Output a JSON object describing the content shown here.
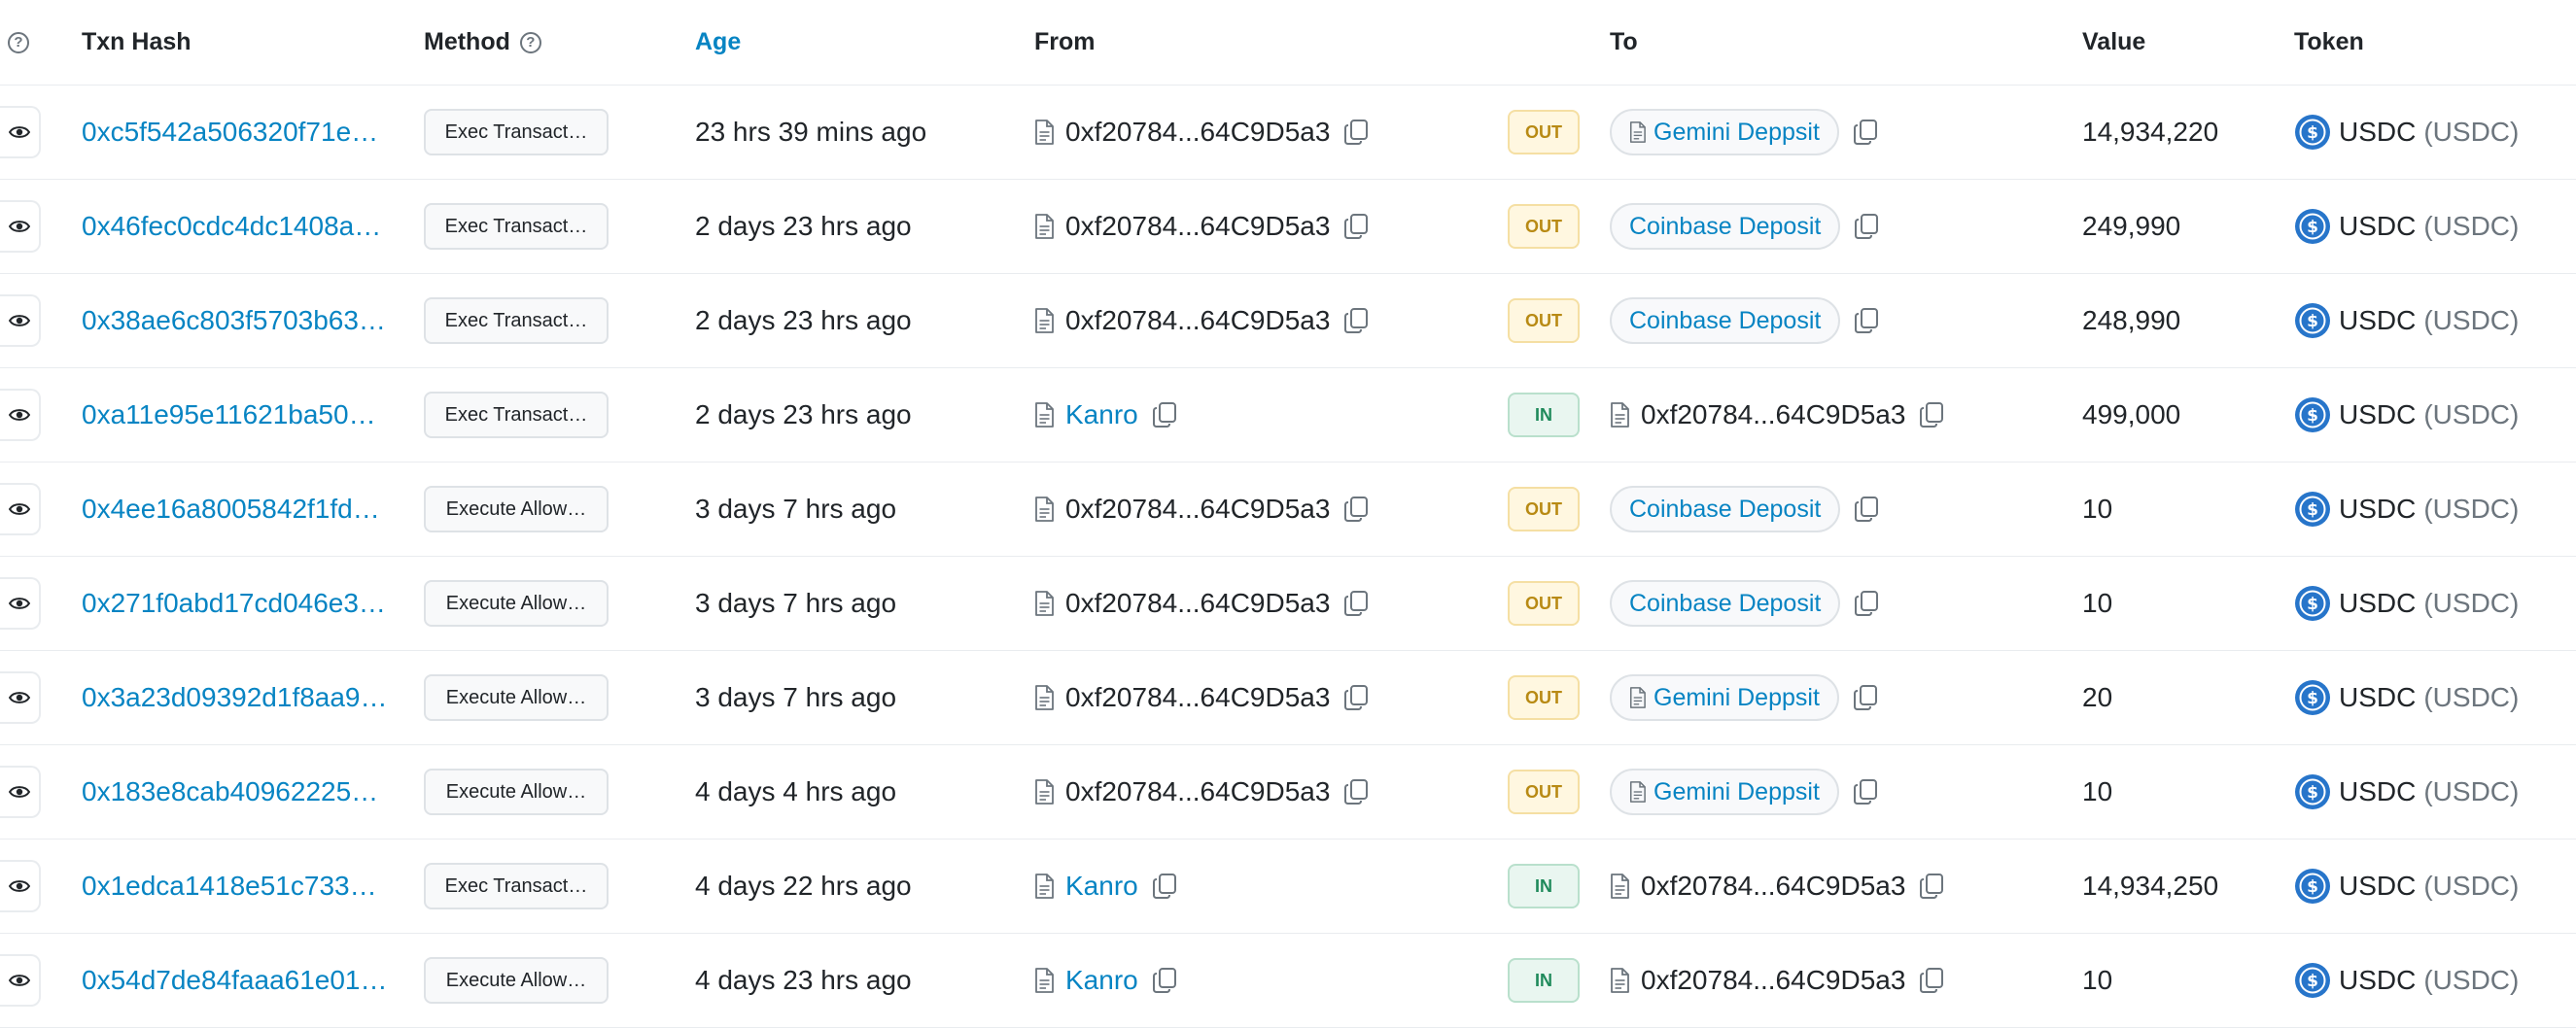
{
  "header": {
    "txn_hash": "Txn Hash",
    "method": "Method",
    "age": "Age",
    "from": "From",
    "to": "To",
    "value": "Value",
    "token": "Token",
    "help_glyph": "?"
  },
  "rows": [
    {
      "hash": "0xc5f542a506320f71e…",
      "method": "Exec Transact…",
      "age": "23 hrs 39 mins ago",
      "from": "0xf20784...64C9D5a3",
      "direction": "OUT",
      "to": "Gemini Deppsit",
      "value": "14,934,220",
      "token": "USDC",
      "token_symbol": "(USDC)"
    },
    {
      "hash": "0x46fec0cdc4dc1408a…",
      "method": "Exec Transact…",
      "age": "2 days 23 hrs ago",
      "from": "0xf20784...64C9D5a3",
      "direction": "OUT",
      "to": "Coinbase Deposit",
      "value": "249,990",
      "token": "USDC",
      "token_symbol": "(USDC)"
    },
    {
      "hash": "0x38ae6c803f5703b63…",
      "method": "Exec Transact…",
      "age": "2 days 23 hrs ago",
      "from": "0xf20784...64C9D5a3",
      "direction": "OUT",
      "to": "Coinbase Deposit",
      "value": "248,990",
      "token": "USDC",
      "token_symbol": "(USDC)"
    },
    {
      "hash": "0xa11e95e11621ba50…",
      "method": "Exec Transact…",
      "age": "2 days 23 hrs ago",
      "from": "Kanro",
      "direction": "IN",
      "to": "0xf20784...64C9D5a3",
      "value": "499,000",
      "token": "USDC",
      "token_symbol": "(USDC)"
    },
    {
      "hash": "0x4ee16a8005842f1fd…",
      "method": "Execute Allow…",
      "age": "3 days 7 hrs ago",
      "from": "0xf20784...64C9D5a3",
      "direction": "OUT",
      "to": "Coinbase Deposit",
      "value": "10",
      "token": "USDC",
      "token_symbol": "(USDC)"
    },
    {
      "hash": "0x271f0abd17cd046e3…",
      "method": "Execute Allow…",
      "age": "3 days 7 hrs ago",
      "from": "0xf20784...64C9D5a3",
      "direction": "OUT",
      "to": "Coinbase Deposit",
      "value": "10",
      "token": "USDC",
      "token_symbol": "(USDC)"
    },
    {
      "hash": "0x3a23d09392d1f8aa9…",
      "method": "Execute Allow…",
      "age": "3 days 7 hrs ago",
      "from": "0xf20784...64C9D5a3",
      "direction": "OUT",
      "to": "Gemini Deppsit",
      "value": "20",
      "token": "USDC",
      "token_symbol": "(USDC)"
    },
    {
      "hash": "0x183e8cab40962225…",
      "method": "Execute Allow…",
      "age": "4 days 4 hrs ago",
      "from": "0xf20784...64C9D5a3",
      "direction": "OUT",
      "to": "Gemini Deppsit",
      "value": "10",
      "token": "USDC",
      "token_symbol": "(USDC)"
    },
    {
      "hash": "0x1edca1418e51c733…",
      "method": "Exec Transact…",
      "age": "4 days 22 hrs ago",
      "from": "Kanro",
      "direction": "IN",
      "to": "0xf20784...64C9D5a3",
      "value": "14,934,250",
      "token": "USDC",
      "token_symbol": "(USDC)"
    },
    {
      "hash": "0x54d7de84faaa61e01…",
      "method": "Execute Allow…",
      "age": "4 days 23 hrs ago",
      "from": "Kanro",
      "direction": "IN",
      "to": "0xf20784...64C9D5a3",
      "value": "10",
      "token": "USDC",
      "token_symbol": "(USDC)"
    }
  ]
}
